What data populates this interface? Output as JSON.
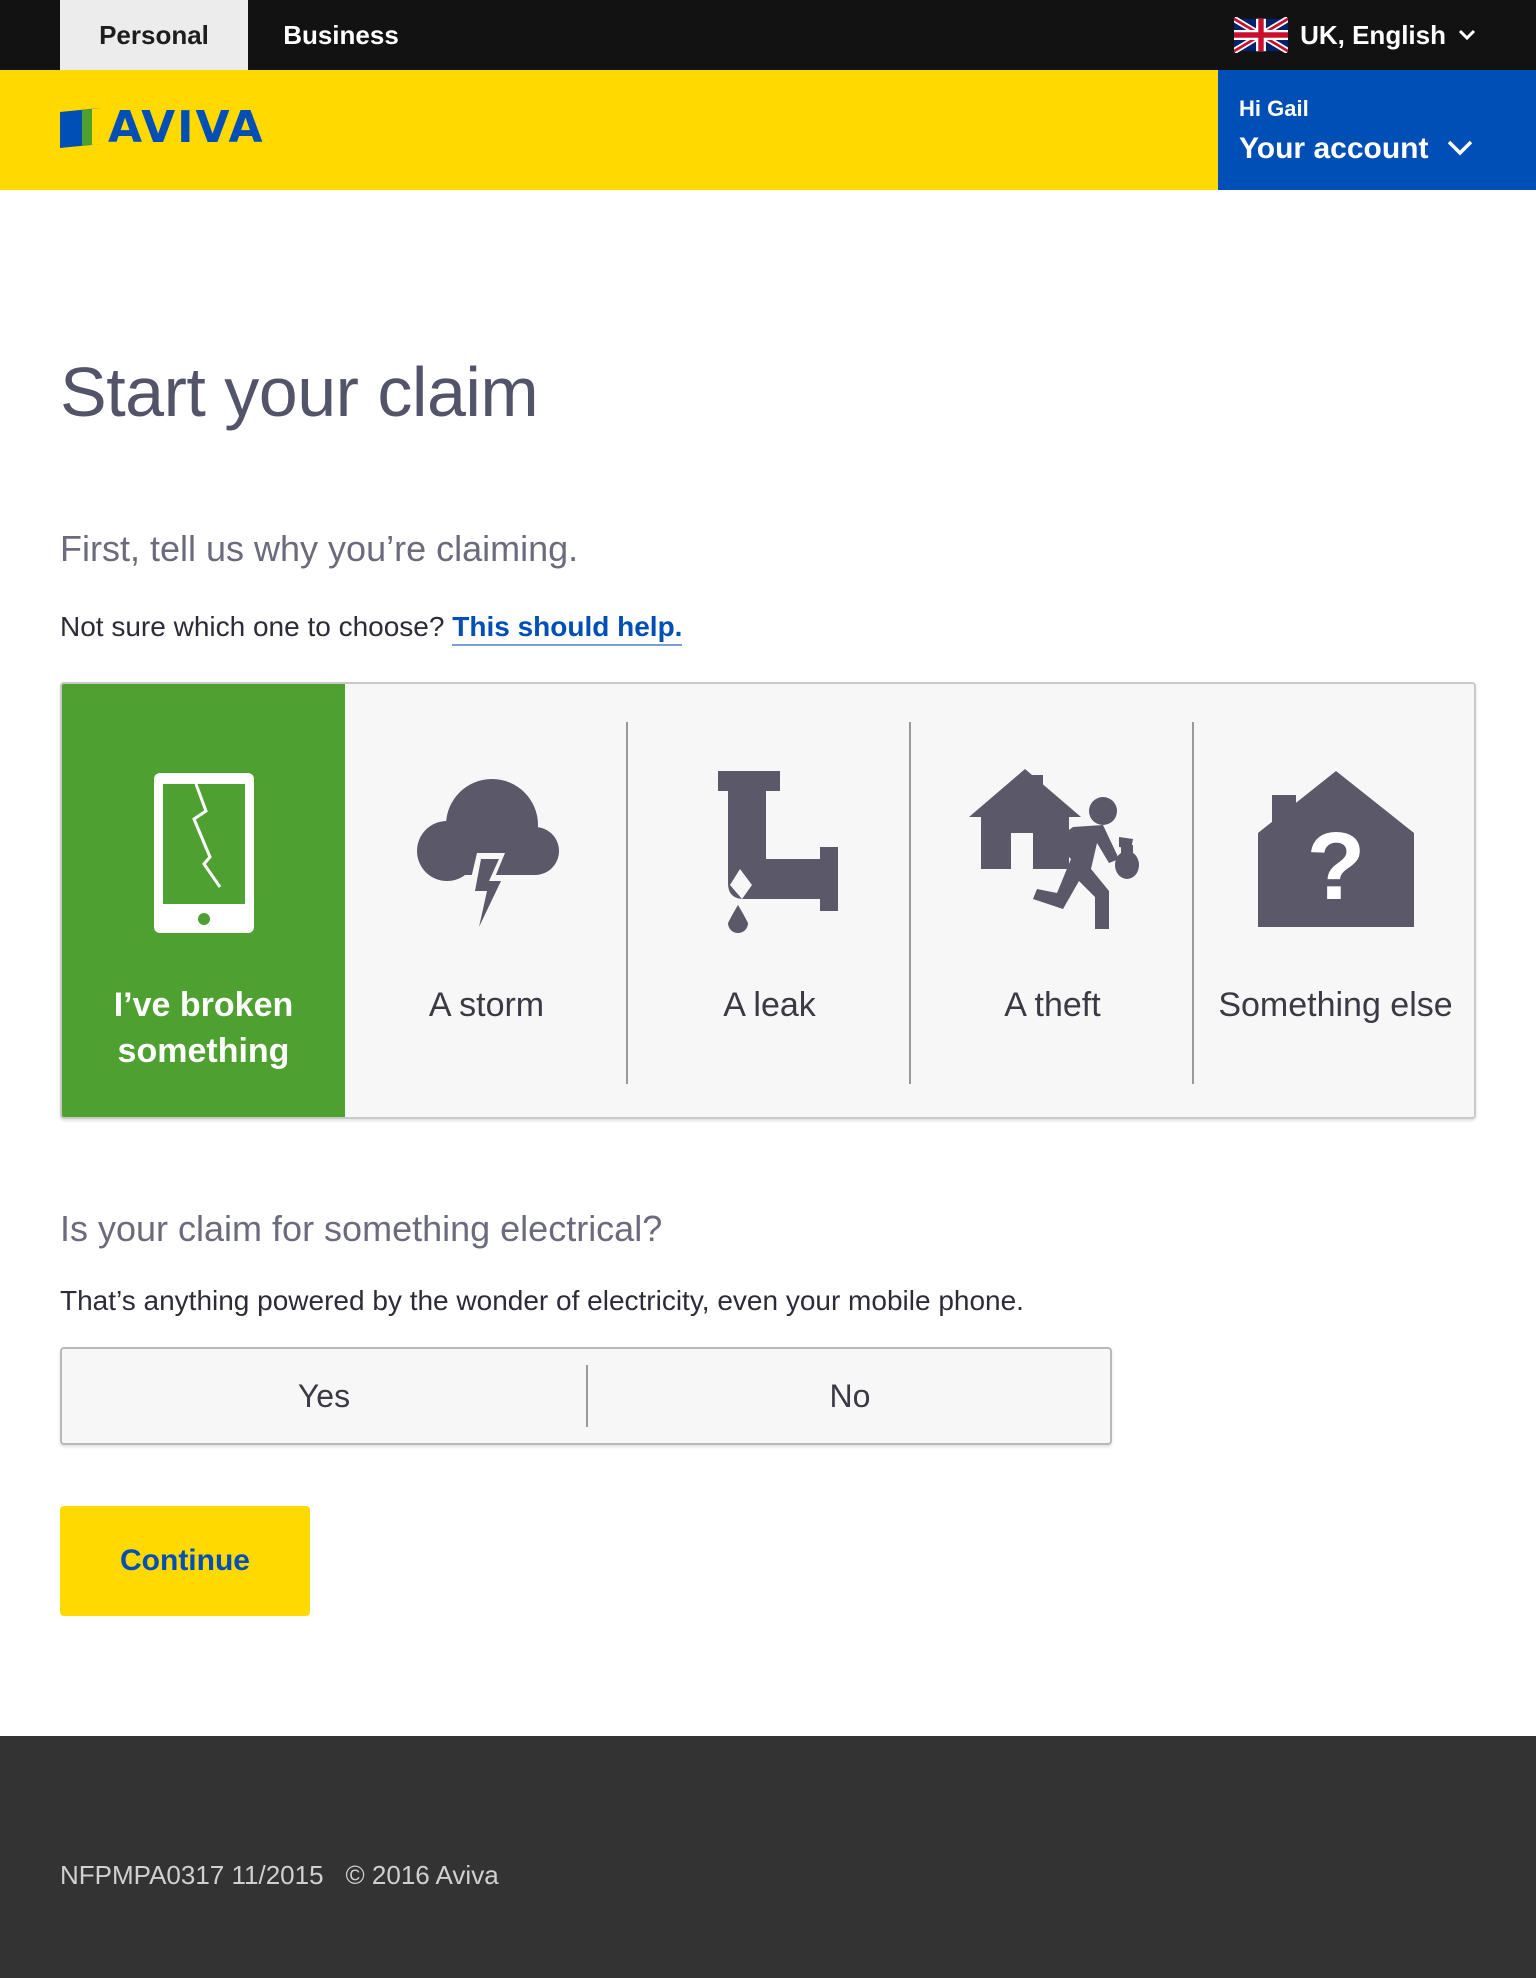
{
  "topbar": {
    "tabs": [
      {
        "label": "Personal",
        "active": true
      },
      {
        "label": "Business",
        "active": false
      }
    ],
    "locale": {
      "label": "UK, English",
      "icon": "uk-flag-icon"
    }
  },
  "header": {
    "logo_text": "AVIVA",
    "account": {
      "greeting": "Hi Gail",
      "label": "Your account",
      "icon": "chevron-down-icon"
    }
  },
  "main": {
    "title": "Start your claim",
    "intro": "First, tell us why you’re claiming.",
    "help_prefix": "Not sure which one to choose? ",
    "help_link": "This should help.",
    "claim_options": [
      {
        "label": "I’ve broken something",
        "icon": "broken-phone-icon",
        "selected": true
      },
      {
        "label": "A storm",
        "icon": "storm-cloud-icon",
        "selected": false
      },
      {
        "label": "A leak",
        "icon": "leaking-pipe-icon",
        "selected": false
      },
      {
        "label": "A theft",
        "icon": "burglar-house-icon",
        "selected": false
      },
      {
        "label": "Something else",
        "icon": "question-house-icon",
        "selected": false
      }
    ],
    "electrical_question": "Is your claim for something electrical?",
    "electrical_desc": "That’s anything powered by the wonder of electricity, even your mobile phone.",
    "yes_label": "Yes",
    "no_label": "No",
    "continue_label": "Continue"
  },
  "footer": {
    "code": "NFPMPA0317 11/2015",
    "copyright": "© 2016 Aviva"
  },
  "colors": {
    "brand_yellow": "#ffd900",
    "brand_blue": "#004fb6",
    "selected_green": "#4ea031",
    "icon_gray": "#5a5869",
    "topbar": "#121212",
    "footer": "#333333"
  }
}
